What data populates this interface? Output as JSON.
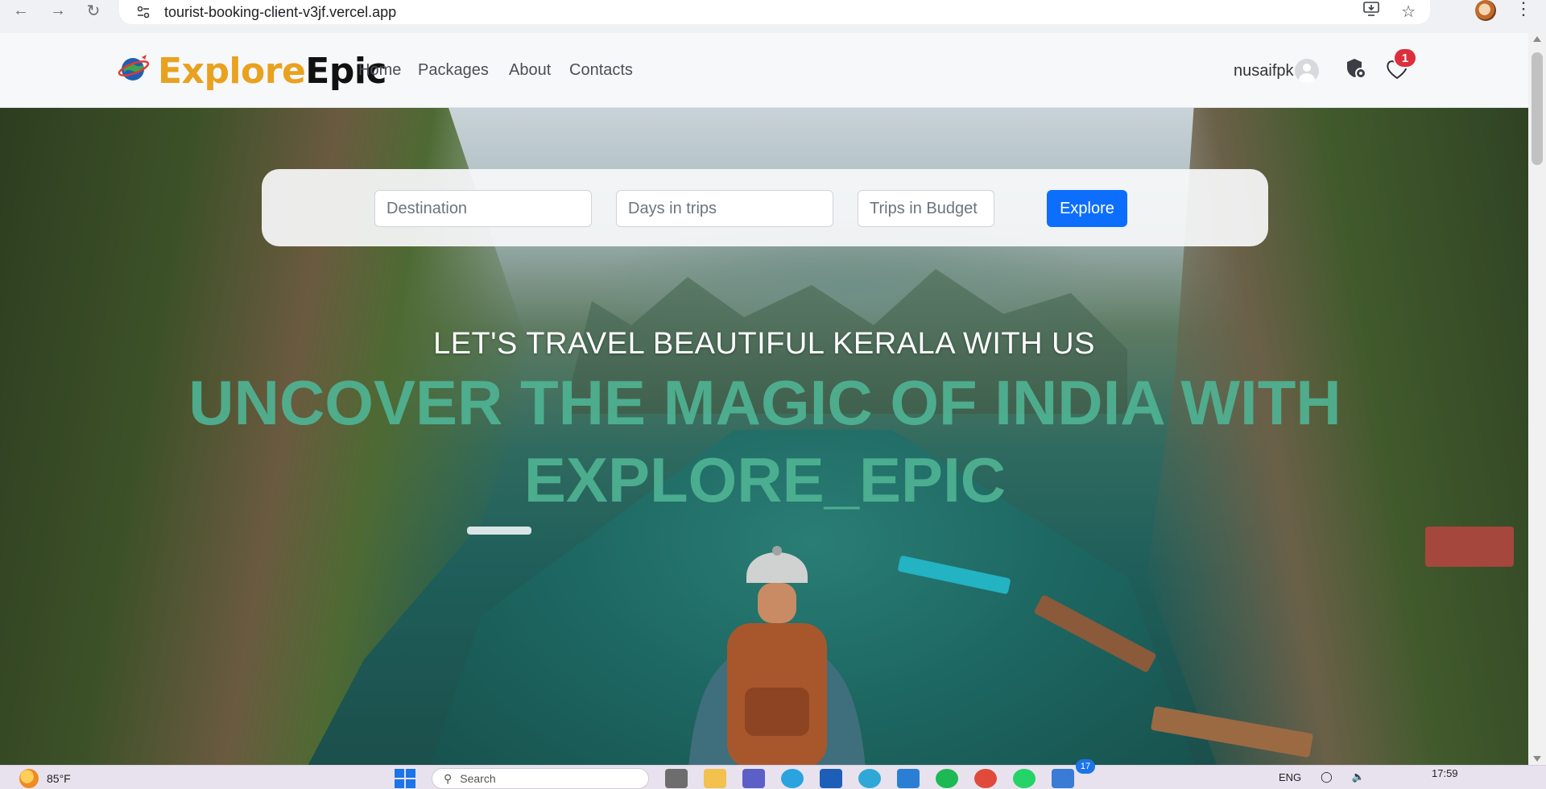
{
  "browser": {
    "url": "tourist-booking-client-v3jf.vercel.app",
    "icons": [
      "back-icon",
      "forward-icon",
      "reload-icon",
      "site-info-icon",
      "install-app-icon",
      "bookmark-star-icon",
      "profile-icon",
      "menu-icon"
    ]
  },
  "header": {
    "logo_part1": "Explore",
    "logo_part2": "Epic",
    "nav": {
      "home": "Home",
      "packages": "Packages",
      "about": "About",
      "contacts": "Contacts"
    },
    "username": "nusaifpk",
    "wishlist_count": "1",
    "accent_color": "#e8a21f"
  },
  "search": {
    "destination_placeholder": "Destination",
    "days_placeholder": "Days in trips",
    "budget_placeholder": "Trips in Budget",
    "explore_label": "Explore",
    "button_color": "#0d6efd"
  },
  "hero": {
    "subtitle": "LET'S TRAVEL BEAUTIFUL KERALA WITH US",
    "title": "UNCOVER THE MAGIC OF INDIA WITH EXPLORE_EPIC",
    "title_color": "#4fb393"
  },
  "taskbar": {
    "weather": "85°F",
    "search_placeholder": "Search",
    "notification_count": "17",
    "language": "ENG",
    "time": "17:59"
  }
}
